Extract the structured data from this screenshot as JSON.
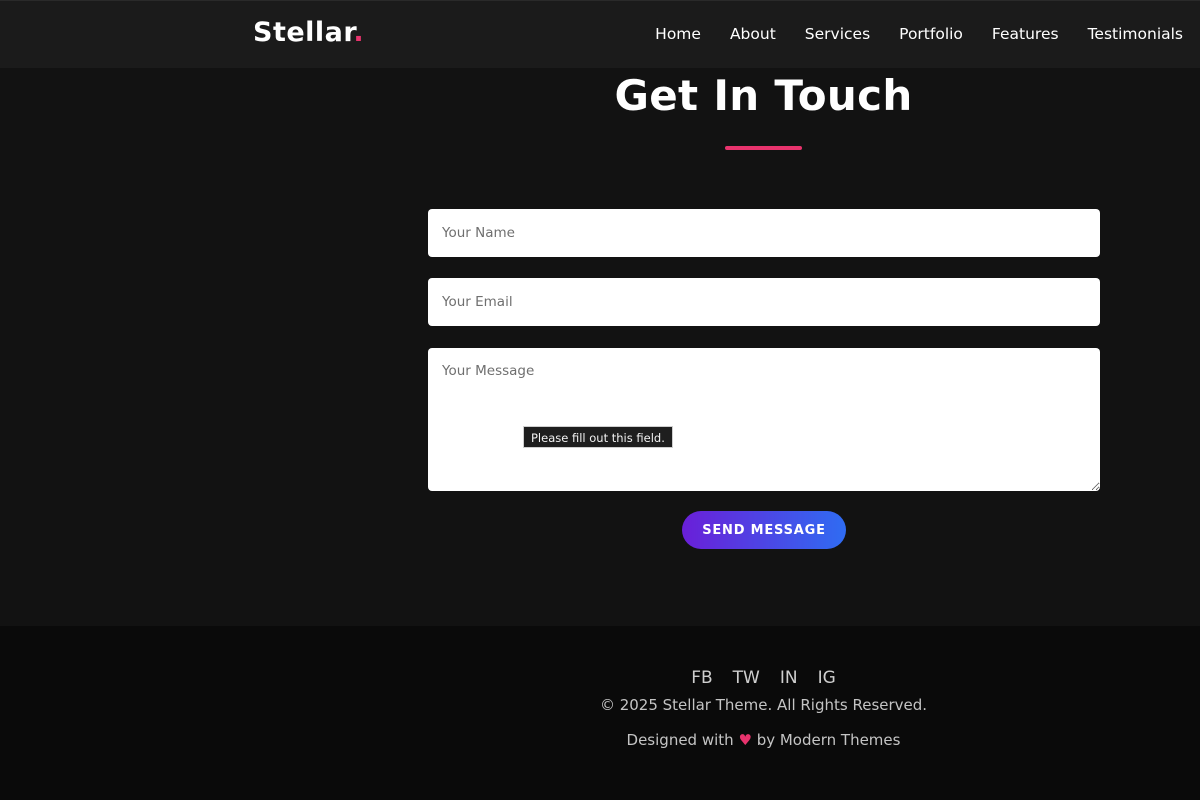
{
  "header": {
    "logo_text": "Stellar",
    "logo_dot": ".",
    "nav": [
      {
        "label": "Home"
      },
      {
        "label": "About"
      },
      {
        "label": "Services"
      },
      {
        "label": "Portfolio"
      },
      {
        "label": "Features"
      },
      {
        "label": "Testimonials"
      }
    ]
  },
  "contact": {
    "title": "Get In Touch",
    "name_placeholder": "Your Name",
    "email_placeholder": "Your Email",
    "message_placeholder": "Your Message",
    "validation_tooltip": "Please fill out this field.",
    "send_label": "SEND MESSAGE"
  },
  "footer": {
    "social": [
      {
        "label": "FB"
      },
      {
        "label": "TW"
      },
      {
        "label": "IN"
      },
      {
        "label": "IG"
      }
    ],
    "copyright": "© 2025 Stellar Theme. All Rights Reserved.",
    "credit_prefix": "Designed with",
    "credit_heart": "♥",
    "credit_suffix": "by Modern Themes"
  },
  "colors": {
    "accent": "#e8336d",
    "background": "#121212",
    "nav_background": "#1b1b1b",
    "footer_background": "#0a0a0a",
    "button_gradient_start": "#6a1fd8",
    "button_gradient_end": "#2f6cf2"
  }
}
